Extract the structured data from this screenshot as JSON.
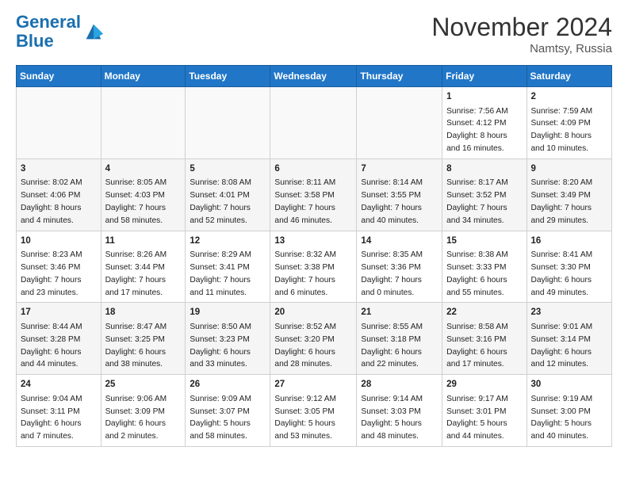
{
  "header": {
    "logo_line1": "General",
    "logo_line2": "Blue",
    "title": "November 2024",
    "location": "Namtsy, Russia"
  },
  "weekdays": [
    "Sunday",
    "Monday",
    "Tuesday",
    "Wednesday",
    "Thursday",
    "Friday",
    "Saturday"
  ],
  "weeks": [
    [
      {
        "day": "",
        "info": ""
      },
      {
        "day": "",
        "info": ""
      },
      {
        "day": "",
        "info": ""
      },
      {
        "day": "",
        "info": ""
      },
      {
        "day": "",
        "info": ""
      },
      {
        "day": "1",
        "info": "Sunrise: 7:56 AM\nSunset: 4:12 PM\nDaylight: 8 hours\nand 16 minutes."
      },
      {
        "day": "2",
        "info": "Sunrise: 7:59 AM\nSunset: 4:09 PM\nDaylight: 8 hours\nand 10 minutes."
      }
    ],
    [
      {
        "day": "3",
        "info": "Sunrise: 8:02 AM\nSunset: 4:06 PM\nDaylight: 8 hours\nand 4 minutes."
      },
      {
        "day": "4",
        "info": "Sunrise: 8:05 AM\nSunset: 4:03 PM\nDaylight: 7 hours\nand 58 minutes."
      },
      {
        "day": "5",
        "info": "Sunrise: 8:08 AM\nSunset: 4:01 PM\nDaylight: 7 hours\nand 52 minutes."
      },
      {
        "day": "6",
        "info": "Sunrise: 8:11 AM\nSunset: 3:58 PM\nDaylight: 7 hours\nand 46 minutes."
      },
      {
        "day": "7",
        "info": "Sunrise: 8:14 AM\nSunset: 3:55 PM\nDaylight: 7 hours\nand 40 minutes."
      },
      {
        "day": "8",
        "info": "Sunrise: 8:17 AM\nSunset: 3:52 PM\nDaylight: 7 hours\nand 34 minutes."
      },
      {
        "day": "9",
        "info": "Sunrise: 8:20 AM\nSunset: 3:49 PM\nDaylight: 7 hours\nand 29 minutes."
      }
    ],
    [
      {
        "day": "10",
        "info": "Sunrise: 8:23 AM\nSunset: 3:46 PM\nDaylight: 7 hours\nand 23 minutes."
      },
      {
        "day": "11",
        "info": "Sunrise: 8:26 AM\nSunset: 3:44 PM\nDaylight: 7 hours\nand 17 minutes."
      },
      {
        "day": "12",
        "info": "Sunrise: 8:29 AM\nSunset: 3:41 PM\nDaylight: 7 hours\nand 11 minutes."
      },
      {
        "day": "13",
        "info": "Sunrise: 8:32 AM\nSunset: 3:38 PM\nDaylight: 7 hours\nand 6 minutes."
      },
      {
        "day": "14",
        "info": "Sunrise: 8:35 AM\nSunset: 3:36 PM\nDaylight: 7 hours\nand 0 minutes."
      },
      {
        "day": "15",
        "info": "Sunrise: 8:38 AM\nSunset: 3:33 PM\nDaylight: 6 hours\nand 55 minutes."
      },
      {
        "day": "16",
        "info": "Sunrise: 8:41 AM\nSunset: 3:30 PM\nDaylight: 6 hours\nand 49 minutes."
      }
    ],
    [
      {
        "day": "17",
        "info": "Sunrise: 8:44 AM\nSunset: 3:28 PM\nDaylight: 6 hours\nand 44 minutes."
      },
      {
        "day": "18",
        "info": "Sunrise: 8:47 AM\nSunset: 3:25 PM\nDaylight: 6 hours\nand 38 minutes."
      },
      {
        "day": "19",
        "info": "Sunrise: 8:50 AM\nSunset: 3:23 PM\nDaylight: 6 hours\nand 33 minutes."
      },
      {
        "day": "20",
        "info": "Sunrise: 8:52 AM\nSunset: 3:20 PM\nDaylight: 6 hours\nand 28 minutes."
      },
      {
        "day": "21",
        "info": "Sunrise: 8:55 AM\nSunset: 3:18 PM\nDaylight: 6 hours\nand 22 minutes."
      },
      {
        "day": "22",
        "info": "Sunrise: 8:58 AM\nSunset: 3:16 PM\nDaylight: 6 hours\nand 17 minutes."
      },
      {
        "day": "23",
        "info": "Sunrise: 9:01 AM\nSunset: 3:14 PM\nDaylight: 6 hours\nand 12 minutes."
      }
    ],
    [
      {
        "day": "24",
        "info": "Sunrise: 9:04 AM\nSunset: 3:11 PM\nDaylight: 6 hours\nand 7 minutes."
      },
      {
        "day": "25",
        "info": "Sunrise: 9:06 AM\nSunset: 3:09 PM\nDaylight: 6 hours\nand 2 minutes."
      },
      {
        "day": "26",
        "info": "Sunrise: 9:09 AM\nSunset: 3:07 PM\nDaylight: 5 hours\nand 58 minutes."
      },
      {
        "day": "27",
        "info": "Sunrise: 9:12 AM\nSunset: 3:05 PM\nDaylight: 5 hours\nand 53 minutes."
      },
      {
        "day": "28",
        "info": "Sunrise: 9:14 AM\nSunset: 3:03 PM\nDaylight: 5 hours\nand 48 minutes."
      },
      {
        "day": "29",
        "info": "Sunrise: 9:17 AM\nSunset: 3:01 PM\nDaylight: 5 hours\nand 44 minutes."
      },
      {
        "day": "30",
        "info": "Sunrise: 9:19 AM\nSunset: 3:00 PM\nDaylight: 5 hours\nand 40 minutes."
      }
    ]
  ]
}
